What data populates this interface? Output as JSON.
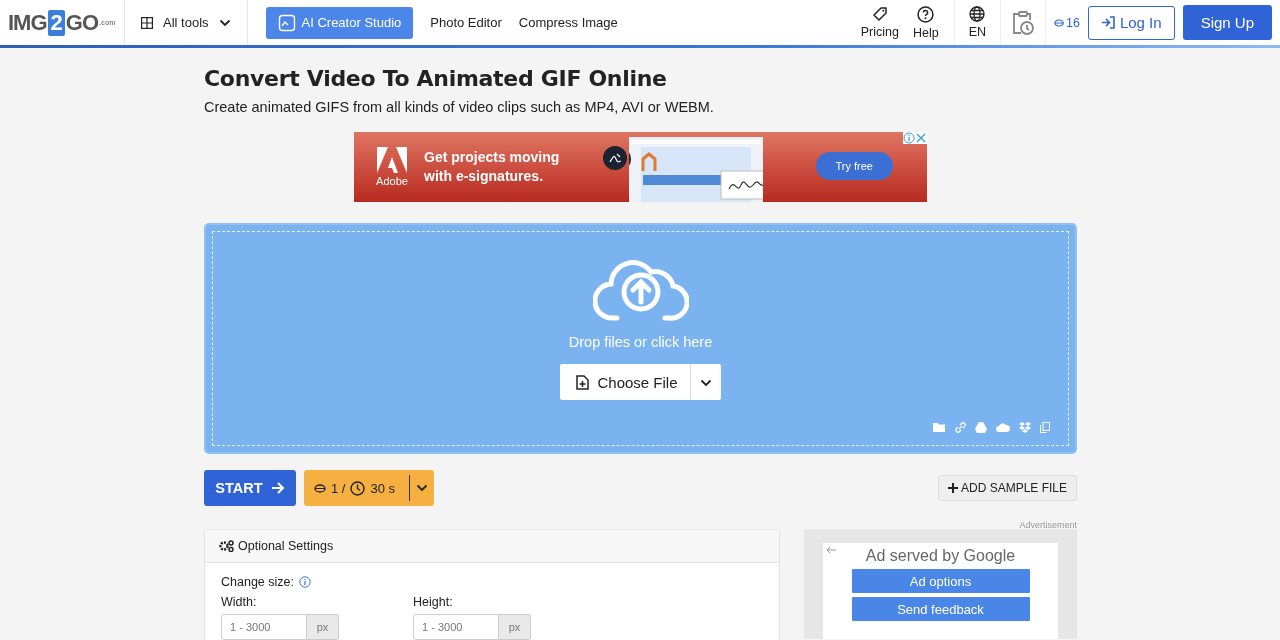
{
  "header": {
    "logo": {
      "prefix": "IMG",
      "badge": "2",
      "suffix": "GO",
      "tld": ".com"
    },
    "all_tools": "All tools",
    "nav": [
      {
        "label": "AI Creator Studio",
        "kind": "primary"
      },
      {
        "label": "Photo Editor",
        "kind": "link"
      },
      {
        "label": "Compress Image",
        "kind": "link"
      }
    ],
    "utility": [
      {
        "label": "Pricing",
        "kind": "tag"
      },
      {
        "label": "Help",
        "kind": "help"
      },
      {
        "label": "EN",
        "kind": "globe"
      }
    ],
    "credits": "16",
    "login": "Log In",
    "signup": "Sign Up"
  },
  "page": {
    "title": "Convert Video To Animated GIF Online",
    "subtitle": "Create animated GIFS from all kinds of video clips such as MP4, AVI or WEBM."
  },
  "ad_banner": {
    "brand": "Adobe",
    "headline": "Get projects moving with e-signatures.",
    "cta": "Try free"
  },
  "dropzone": {
    "prompt": "Drop files or click here",
    "button": "Choose File"
  },
  "actions": {
    "start": "START",
    "credits": "1 /",
    "time": "30 s",
    "sample": "ADD SAMPLE FILE"
  },
  "ad_label": "Advertisement",
  "settings": {
    "title": "Optional Settings",
    "change_size": "Change size:",
    "fields": [
      {
        "label": "Width:",
        "placeholder": "1 - 3000",
        "unit": "px"
      },
      {
        "label": "Height:",
        "placeholder": "1 - 3000",
        "unit": "px"
      }
    ]
  },
  "google_ad": {
    "served_by": "Ad served by Google",
    "buttons": [
      "Ad options",
      "Send feedback"
    ]
  }
}
